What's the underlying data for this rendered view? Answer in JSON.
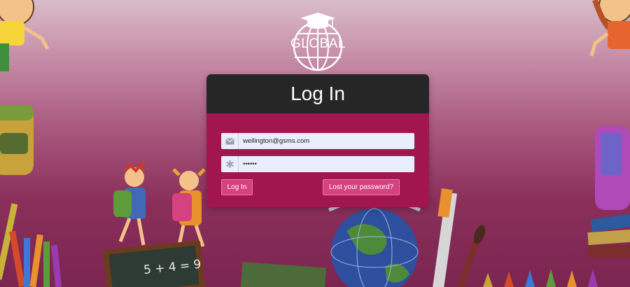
{
  "logo": {
    "text": "GLOBAL",
    "icon": "globe-graduation-cap-icon"
  },
  "login": {
    "title": "Log In",
    "email": {
      "value": "wellington@gsms.com",
      "placeholder": "",
      "icon": "envelope-icon"
    },
    "password": {
      "value": "••••••",
      "placeholder": "",
      "icon": "asterisk-icon"
    },
    "submit_label": "Log In",
    "lost_password_label": "Lost your password?"
  },
  "decor": {
    "chalkboard_text": "5 + 4 = 9"
  },
  "colors": {
    "header": "#262626",
    "card_body": "#a2164e",
    "button": "#d6417f",
    "input_bg": "#e8eefb"
  }
}
